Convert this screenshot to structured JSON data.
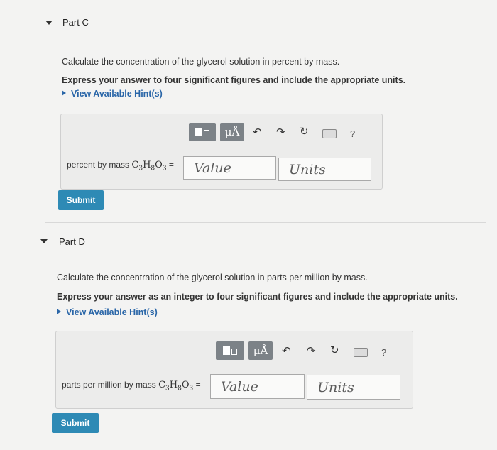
{
  "part_c": {
    "title": "Part C",
    "question": "Calculate the concentration of the glycerol solution in percent by mass.",
    "instruction": "Express your answer to four significant figures and include the appropriate units.",
    "hint_link": "View Available Hint(s)",
    "answer_label": "percent by mass",
    "formula": {
      "c": "C",
      "c_sub": "3",
      "h": "H",
      "h_sub": "8",
      "o": "O",
      "o_sub": "3"
    },
    "equals": "=",
    "value_placeholder": "Value",
    "units_placeholder": "Units",
    "submit_label": "Submit",
    "toolbar": {
      "mu_label": "μÅ",
      "help": "?"
    }
  },
  "part_d": {
    "title": "Part D",
    "question": "Calculate the concentration of the glycerol solution in parts per million by mass.",
    "instruction": "Express your answer as an integer to four significant figures and include the appropriate units.",
    "hint_link": "View Available Hint(s)",
    "answer_label": "parts per million by mass",
    "formula": {
      "c": "C",
      "c_sub": "3",
      "h": "H",
      "h_sub": "8",
      "o": "O",
      "o_sub": "3"
    },
    "equals": "=",
    "value_placeholder": "Value",
    "units_placeholder": "Units",
    "submit_label": "Submit",
    "toolbar": {
      "mu_label": "μÅ",
      "help": "?"
    }
  },
  "icons": [
    "collapse-caret-icon",
    "templates-icon",
    "undo-icon",
    "redo-icon",
    "reset-icon",
    "keyboard-icon",
    "help-icon",
    "hint-arrow-icon"
  ]
}
